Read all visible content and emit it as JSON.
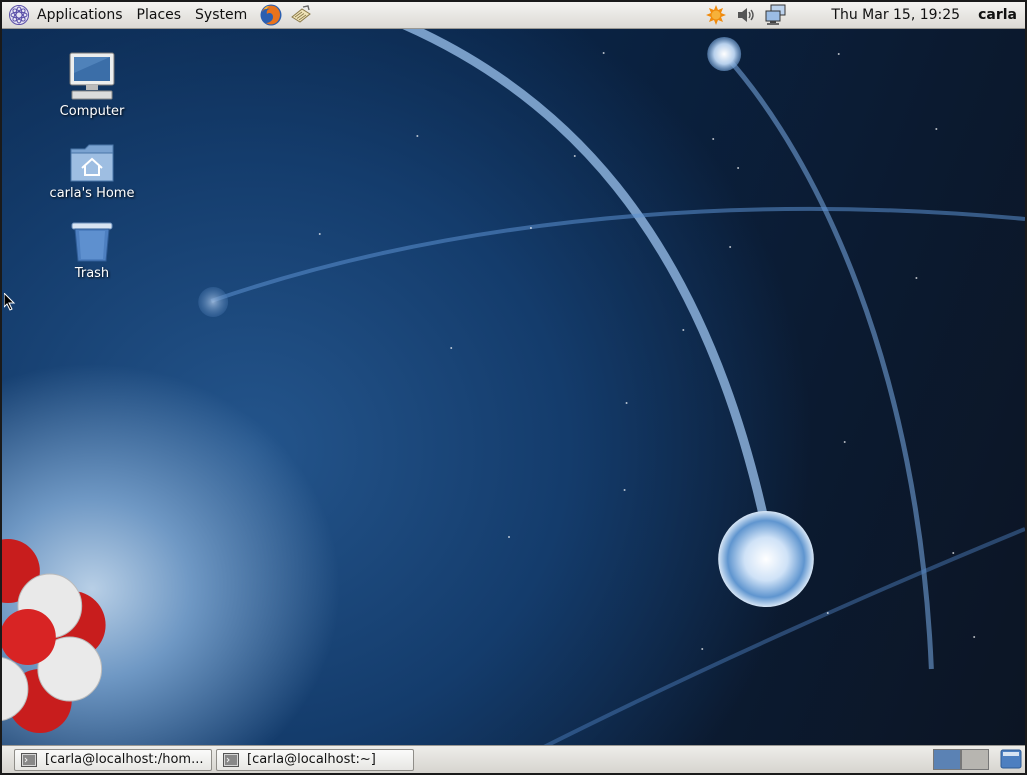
{
  "top_panel": {
    "menu": {
      "applications": "Applications",
      "places": "Places",
      "system": "System"
    },
    "launchers": [
      "firefox-icon",
      "notes-icon"
    ],
    "tray_icons": [
      "update-notifier-icon",
      "volume-icon",
      "network-icon"
    ],
    "clock": "Thu Mar 15, 19:25",
    "user": "carla"
  },
  "desktop": {
    "icons": [
      {
        "label": "Computer",
        "icon": "computer-icon"
      },
      {
        "label": "carla's Home",
        "icon": "home-folder-icon"
      },
      {
        "label": "Trash",
        "icon": "trash-icon"
      }
    ]
  },
  "bottom_panel": {
    "tasks": [
      {
        "label": "[carla@localhost:/hom..."
      },
      {
        "label": "[carla@localhost:~]"
      }
    ],
    "workspaces": [
      "active",
      "inactive"
    ]
  },
  "colors": {
    "panel": "#dcdad5",
    "wallpaper_dark": "#0a2446",
    "workspace_active": "#5b82b4"
  }
}
